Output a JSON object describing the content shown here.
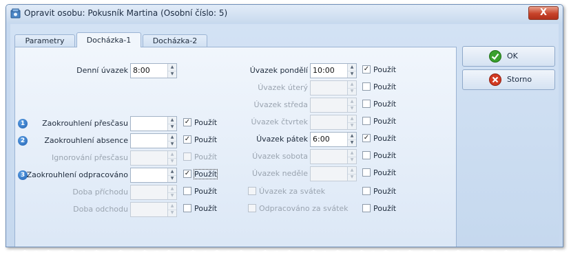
{
  "window": {
    "title": "Opravit osobu: Pokusník Martina (Osobní číslo: 5)",
    "close_glyph": "X"
  },
  "tabs": [
    {
      "label": "Parametry"
    },
    {
      "label": "Docházka-1"
    },
    {
      "label": "Docházka-2"
    }
  ],
  "left": {
    "denni_uvazek": {
      "label": "Denní úvazek",
      "value": "8:00"
    },
    "rows": [
      {
        "label": "Zaokrouhlení přesčasu",
        "value": "",
        "check_label": "Použít",
        "checked": true,
        "badge": "1"
      },
      {
        "label": "Zaokrouhlení absence",
        "value": "",
        "check_label": "Použít",
        "checked": true,
        "badge": "2"
      },
      {
        "label": "Ignorování přesčasu",
        "value": "",
        "check_label": "Použít",
        "checked": false
      },
      {
        "label": "Zaokrouhlení odpracováno",
        "value": "",
        "check_label": "Použít",
        "checked": true,
        "badge": "3"
      },
      {
        "label": "Doba příchodu",
        "value": "",
        "check_label": "Použít",
        "checked": false
      },
      {
        "label": "Doba odchodu",
        "value": "",
        "check_label": "Použít",
        "checked": false
      }
    ]
  },
  "right": {
    "rows": [
      {
        "label": "Úvazek pondělí",
        "value": "10:00",
        "check_label": "Použít",
        "checked": true
      },
      {
        "label": "Úvazek úterý",
        "value": "",
        "check_label": "Použít",
        "checked": false
      },
      {
        "label": "Úvazek středa",
        "value": "",
        "check_label": "Použít",
        "checked": false
      },
      {
        "label": "Úvazek čtvrtek",
        "value": "",
        "check_label": "Použít",
        "checked": false
      },
      {
        "label": "Úvazek pátek",
        "value": "6:00",
        "check_label": "Použít",
        "checked": true
      },
      {
        "label": "Úvazek sobota",
        "value": "",
        "check_label": "Použít",
        "checked": false
      },
      {
        "label": "Úvazek neděle",
        "value": "",
        "check_label": "Použít",
        "checked": false
      }
    ],
    "extra_checks": [
      {
        "label": "Úvazek za svátek",
        "checked": false,
        "check_label": "Použít"
      },
      {
        "label": "Odpracováno za svátek",
        "checked": false,
        "check_label": "Použít"
      }
    ]
  },
  "buttons": {
    "ok": "OK",
    "cancel": "Storno"
  },
  "glyphs": {
    "check": "✓",
    "up": "▲",
    "down": "▼"
  },
  "colors": {
    "window_bg": "#c7d9ef",
    "panel_bg": "#f1f6fc",
    "ok_green": "#3aa12d",
    "cancel_red": "#d23a22",
    "badge_blue": "#2a6cc0"
  }
}
